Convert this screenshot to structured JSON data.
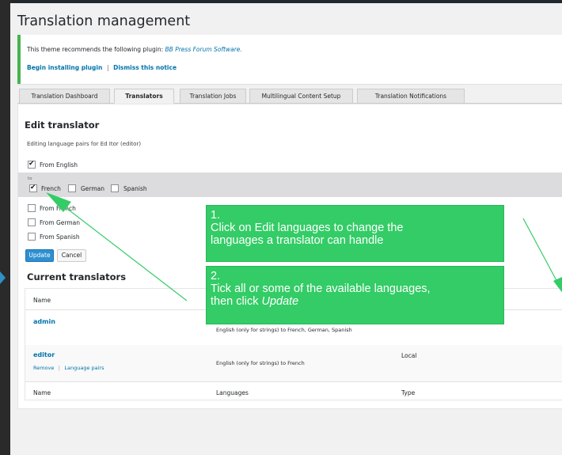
{
  "page": {
    "title": "Translation management"
  },
  "notice": {
    "message_prefix": "This theme recommends the following plugin:",
    "plugin_name": "BB Press Forum Software.",
    "install_link": "Begin installing plugin",
    "separator": "|",
    "dismiss_link": "Dismiss this notice"
  },
  "tabs": [
    {
      "label": "Translation Dashboard",
      "active": false
    },
    {
      "label": "Translators",
      "active": true
    },
    {
      "label": "Translation Jobs",
      "active": false
    },
    {
      "label": "Multilingual Content Setup",
      "active": false
    },
    {
      "label": "Translation Notifications",
      "active": false
    }
  ],
  "edit_translator": {
    "heading": "Edit translator",
    "subtitle": "Editing language pairs for Ed Itor (editor)",
    "from_english": {
      "label": "From English",
      "checked": true
    },
    "to_label": "to",
    "targets": [
      {
        "label": "French",
        "checked": true
      },
      {
        "label": "German",
        "checked": false
      },
      {
        "label": "Spanish",
        "checked": false
      }
    ],
    "from_french": {
      "label": "From French",
      "checked": false
    },
    "from_german": {
      "label": "From German",
      "checked": false
    },
    "from_spanish": {
      "label": "From Spanish",
      "checked": false
    },
    "update_button": "Update",
    "cancel_button": "Cancel"
  },
  "current_translators": {
    "heading": "Current translators",
    "columns": [
      "Name",
      "Languages",
      "Type"
    ],
    "rows": [
      {
        "name": "admin",
        "languages": "English (only for strings) to French, German, Spanish",
        "type": ""
      },
      {
        "name": "editor",
        "languages": "English (only for strings) to French",
        "type": "Local",
        "action_remove": "Remove",
        "action_sep": "|",
        "action_pairs": "Language pairs"
      }
    ]
  },
  "callouts": {
    "first": {
      "line1": "1.",
      "line2": "Click on Edit languages to change the",
      "line3": "languages a translator can handle"
    },
    "second": {
      "line1": "2.",
      "line2": "Tick all or some of the available languages,",
      "line3_prefix": "then click ",
      "line3_em": "Update"
    }
  },
  "colors": {
    "accent": "#0073aa",
    "callout": "#33cc66",
    "update_button": "#2e8fd1",
    "notice_border": "#46b450"
  }
}
